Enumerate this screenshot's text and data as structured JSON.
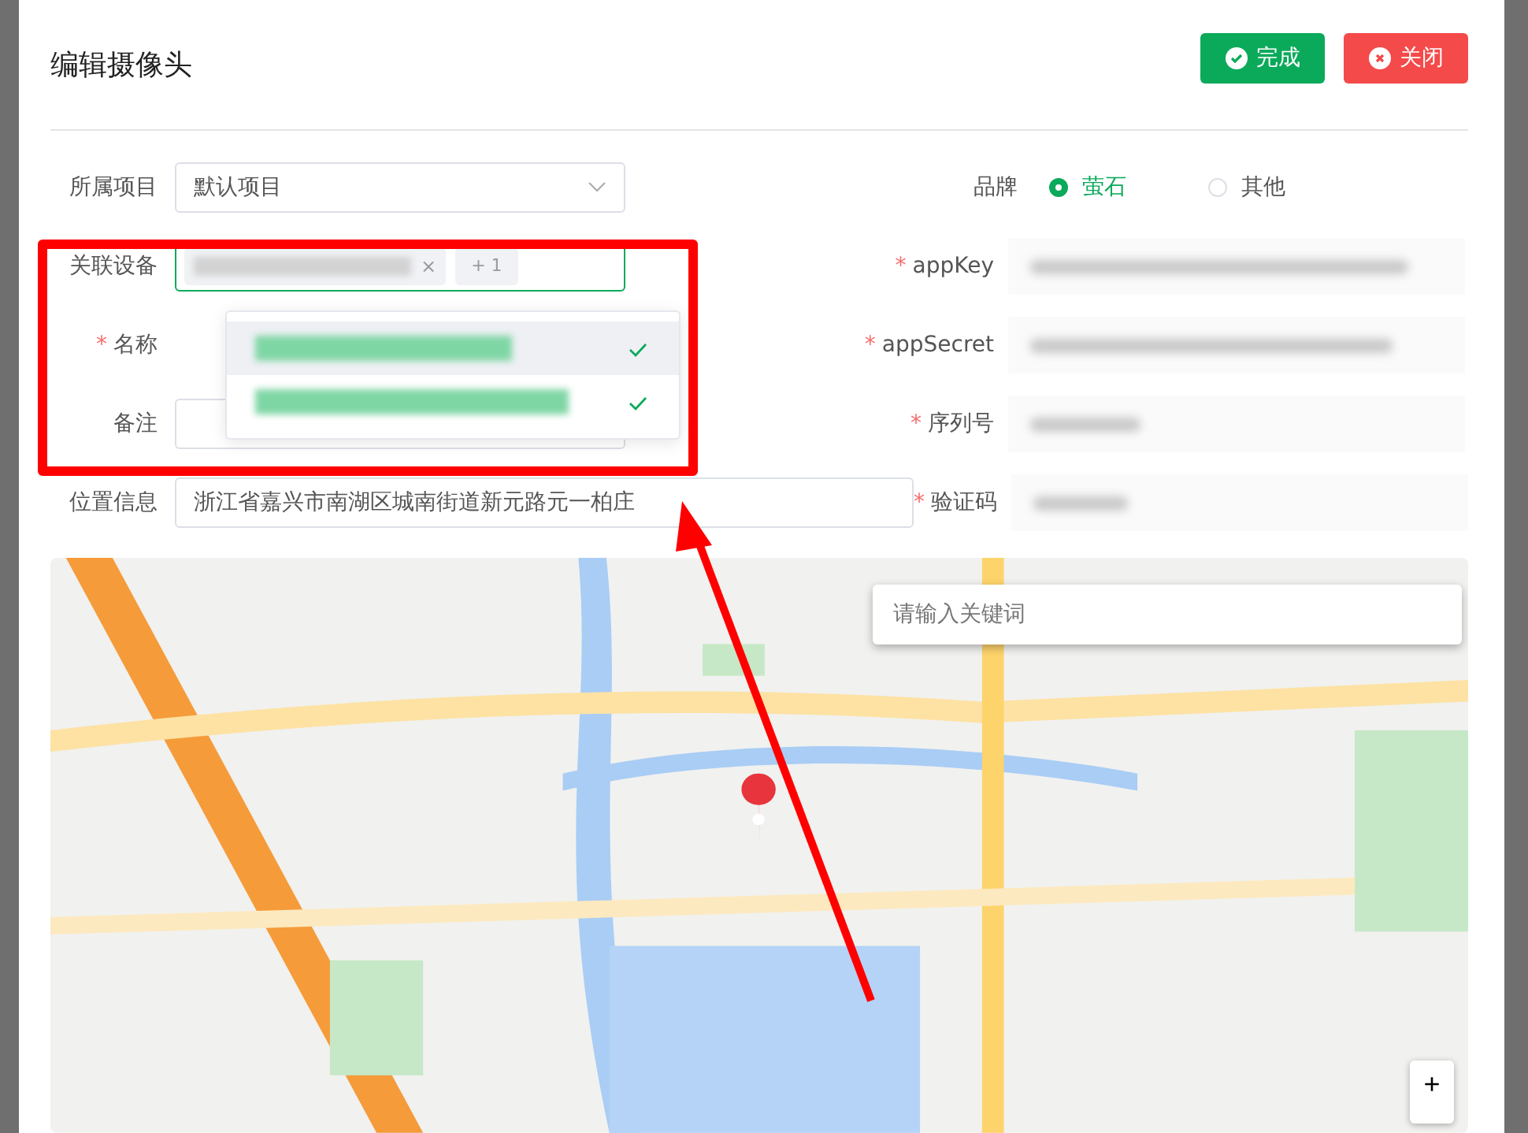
{
  "dialog": {
    "title": "编辑摄像头",
    "buttons": [
      {
        "label": "完成",
        "kind": "confirm"
      },
      {
        "label": "关闭",
        "kind": "close"
      }
    ]
  },
  "form": {
    "project": {
      "label": "所属项目",
      "value": "默认项目"
    },
    "devices": {
      "label": "关联设备",
      "tag_blurred": true,
      "tag_remove": "×",
      "more": "+ 1",
      "focused": true,
      "options": [
        {
          "blurred": true,
          "selected": true,
          "hovered": true
        },
        {
          "blurred": true,
          "selected": true,
          "hovered": false
        }
      ]
    },
    "name": {
      "label": "名称",
      "required_mark": "*"
    },
    "remark": {
      "label": "备注"
    },
    "location": {
      "label": "位置信息",
      "value": "浙江省嘉兴市南湖区城南街道新元路元一柏庄"
    },
    "brand": {
      "label": "品牌",
      "options": [
        {
          "label": "萤石",
          "selected": true
        },
        {
          "label": "其他",
          "selected": false
        }
      ]
    },
    "secrets": [
      {
        "label": "appKey",
        "required_mark": "*",
        "blurred": true
      },
      {
        "label": "appSecret",
        "required_mark": "*",
        "blurred": true
      },
      {
        "label": "序列号",
        "required_mark": "*",
        "blurred": true
      },
      {
        "label": "验证码",
        "required_mark": "*",
        "blurred": true
      }
    ]
  },
  "map": {
    "kind": "picture",
    "search": {
      "placeholder": "请输入关键词"
    },
    "zoom_in": "+"
  }
}
